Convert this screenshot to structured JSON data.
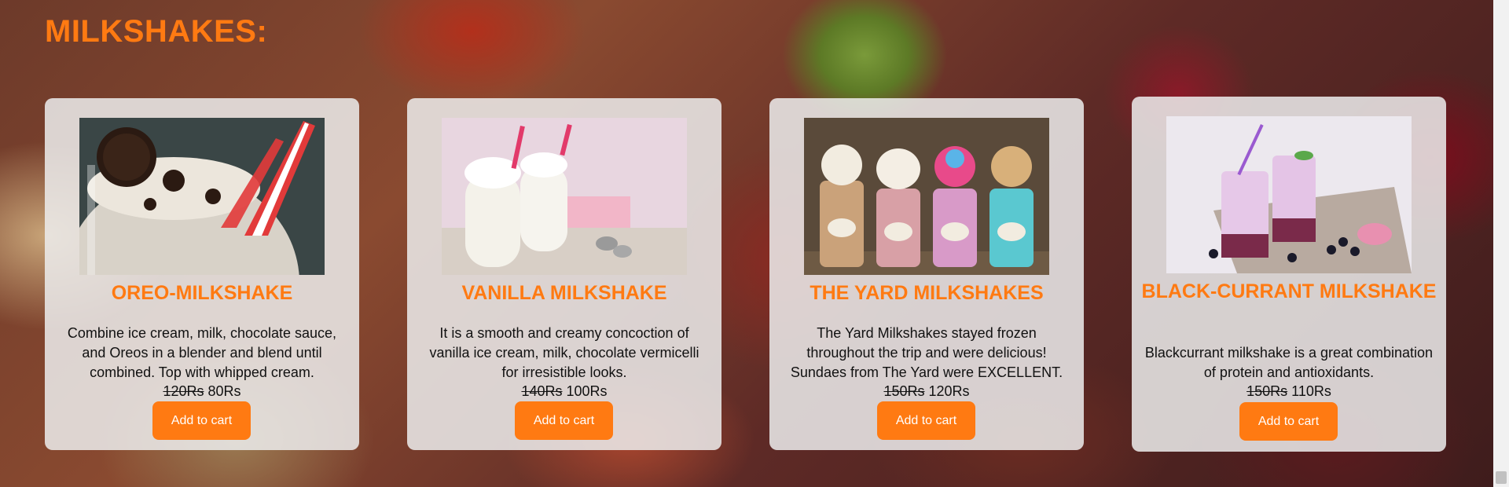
{
  "page": {
    "title": "MILKSHAKES:"
  },
  "products": [
    {
      "name": "OREO-MILKSHAKE",
      "description": "Combine ice cream, milk, chocolate sauce, and Oreos in a blender and blend until combined. Top with whipped cream.",
      "old_price": "120Rs",
      "new_price": "80Rs",
      "button_label": "Add to cart",
      "image": "oreo-milkshake-photo"
    },
    {
      "name": "VANILLA MILKSHAKE",
      "description": "It is a smooth and creamy concoction of vanilla ice cream, milk, chocolate vermicelli for irresistible looks.",
      "old_price": "140Rs",
      "new_price": "100Rs",
      "button_label": "Add to cart",
      "image": "vanilla-milkshake-photo"
    },
    {
      "name": "THE YARD MILKSHAKES",
      "description": "The Yard Milkshakes stayed frozen throughout the trip and were delicious! Sundaes from The Yard were EXCELLENT.",
      "old_price": "150Rs",
      "new_price": "120Rs",
      "button_label": "Add to cart",
      "image": "yard-milkshakes-photo"
    },
    {
      "name": "BLACK-CURRANT MILKSHAKE",
      "description": "Blackcurrant milkshake is a great combination of protein and antioxidants.",
      "old_price": "150Rs",
      "new_price": "110Rs",
      "button_label": "Add to cart",
      "image": "blackcurrant-milkshake-photo"
    }
  ],
  "colors": {
    "accent": "#ff7a12",
    "card_bg": "#ececec",
    "text": "#111111"
  }
}
